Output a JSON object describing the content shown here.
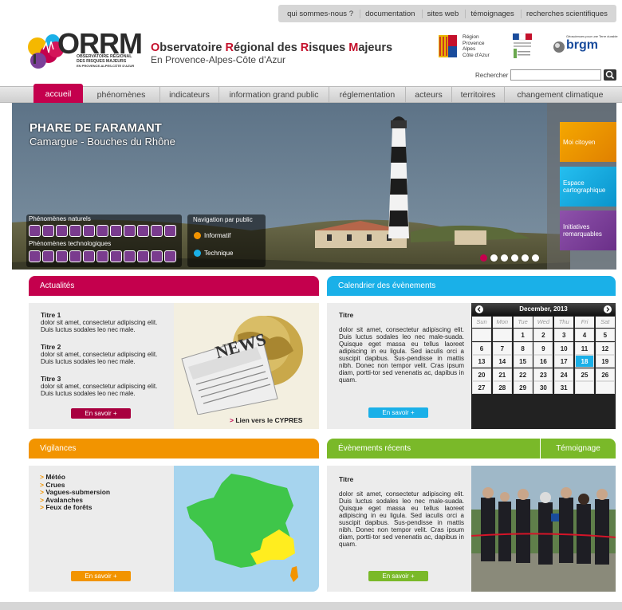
{
  "top_links": [
    "qui sommes-nous ?",
    "documentation",
    "sites web",
    "témoignages",
    "recherches scientifiques"
  ],
  "logo": {
    "acronym": "ORRM",
    "line1": "OBSERVATOIRE RÉGIONAL",
    "line2": "DES RISQUES MAJEURS",
    "line3": "EN PROVENCE-ALPES-CÔTE D'AZUR"
  },
  "header": {
    "title_parts": [
      "O",
      "bservatoire ",
      "R",
      "égional des ",
      "R",
      "isques ",
      "M",
      "ajeurs"
    ],
    "subtitle": "En Provence-Alpes-Côte d'Azur",
    "partner_region": [
      "Région",
      "Provence",
      "Alpes",
      "Côte d'Azur"
    ],
    "partner_brgm": "brgm",
    "partner_brgm_tagline": "Géosciences pour une Terre durable"
  },
  "search": {
    "label": "Rechercher",
    "placeholder": ""
  },
  "nav": [
    "accueil",
    "phénomènes",
    "indicateurs",
    "information grand public",
    "réglementation",
    "acteurs",
    "territoires",
    "changement climatique"
  ],
  "hero": {
    "title": "PHARE DE FARAMANT",
    "subtitle": "Camargue - Bouches du Rhône",
    "natural_label": "Phénomènes naturels",
    "tech_label": "Phénomènes technologiques",
    "navpub_label": "Navigation par public",
    "navpub_items": [
      {
        "label": "Informatif",
        "color": "#f29400"
      },
      {
        "label": "Technique",
        "color": "#1ab0e8"
      }
    ],
    "tiles": [
      {
        "label": "Moi citoyen",
        "color": "#f29400"
      },
      {
        "label": "Espace cartographique",
        "color": "#1ab0e8"
      },
      {
        "label": "Initiatives remarquables",
        "color": "#7b3f98"
      }
    ],
    "slide_count": 6,
    "active_slide": 1
  },
  "actualites": {
    "header": "Actualités",
    "items": [
      {
        "title": "Titre 1",
        "text": "dolor sit amet, consectetur adipiscing elit. Duis luctus sodales leo nec male."
      },
      {
        "title": "Titre 2",
        "text": "dolor sit amet, consectetur adipiscing elit. Duis luctus sodales leo nec male."
      },
      {
        "title": "Titre 3",
        "text": "dolor sit amet, consectetur adipiscing elit. Duis luctus sodales leo nec male."
      }
    ],
    "button": "En savoir +",
    "image_word": "NEWS",
    "link": "Lien vers le CYPRES",
    "color": "#c4004d"
  },
  "calendrier": {
    "header": "Calendrier des évènements",
    "title": "Titre",
    "text": "dolor sit amet, consectetur adipiscing elit. Duis luctus sodales leo nec male-suada. Quisque eget massa eu tellus laoreet adipiscing in eu ligula. Sed iaculis orci a suscipit dapibus. Sus-pendisse in mattis nibh. Donec non tempor velit. Cras ipsum diam, portti-tor sed venenatis ac, dapibus in quam.",
    "button": "En savoir +",
    "color": "#1ab0e8",
    "month": "December, 2013",
    "weekdays": [
      "Sun",
      "Mon",
      "Tue",
      "Wed",
      "Thu",
      "Fri",
      "Sat"
    ],
    "weeks": [
      [
        "",
        "",
        "1",
        "2",
        "3",
        "4",
        "5"
      ],
      [
        "6",
        "7",
        "8",
        "9",
        "10",
        "11",
        "12"
      ],
      [
        "13",
        "14",
        "15",
        "16",
        "17",
        "18",
        "19"
      ],
      [
        "20",
        "21",
        "22",
        "23",
        "24",
        "25",
        "26"
      ],
      [
        "27",
        "28",
        "29",
        "30",
        "31",
        "",
        ""
      ]
    ],
    "today": "18"
  },
  "vigilances": {
    "header": "Vigilances",
    "items": [
      "Météo",
      "Crues",
      "Vagues-submersion",
      "Avalanches",
      "Feux de forêts"
    ],
    "button": "En savoir +",
    "color": "#f29400"
  },
  "evenements": {
    "header": "Évènements récents",
    "header_right": "Témoignage",
    "title": "Titre",
    "text": "dolor sit amet, consectetur adipiscing elit. Duis luctus sodales leo nec male-suada. Quisque eget massa eu tellus laoreet adipiscing in eu ligula. Sed iaculis orci a suscipit dapibus. Sus-pendisse in mattis nibh. Donec non tempor velit. Cras ipsum diam, portti-tor sed venenatis ac, dapibus in quam.",
    "button": "En savoir +",
    "color": "#7ab929"
  },
  "icons": {
    "search": "search-icon",
    "prev": "chevron-left-icon",
    "next": "chevron-right-icon"
  }
}
